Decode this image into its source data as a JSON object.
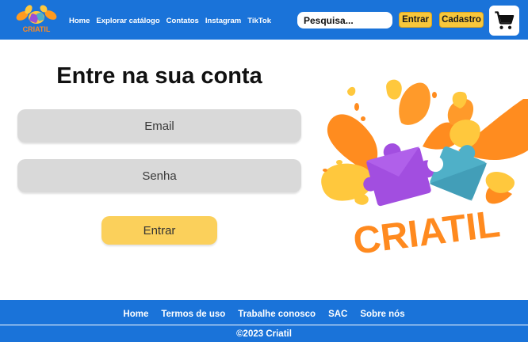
{
  "brand": {
    "logo_text": "CRIATIL",
    "colors": {
      "primary": "#1a73d9",
      "accent": "#f8c73a"
    }
  },
  "header": {
    "nav": [
      "Home",
      "Explorar catálogo",
      "Contatos",
      "Instagram",
      "TikTok"
    ],
    "search_placeholder": "Pesquisa...",
    "login_label": "Entrar",
    "signup_label": "Cadastro",
    "cart_icon": "shopping-cart-icon"
  },
  "main": {
    "title": "Entre na sua conta",
    "email_placeholder": "Email",
    "password_placeholder": "Senha",
    "submit_label": "Entrar",
    "hero_text": "CRIATIL"
  },
  "footer": {
    "links": [
      "Home",
      "Termos de uso",
      "Trabalhe conosco",
      "SAC",
      "Sobre nós"
    ],
    "copyright": "©2023 Criatil"
  }
}
